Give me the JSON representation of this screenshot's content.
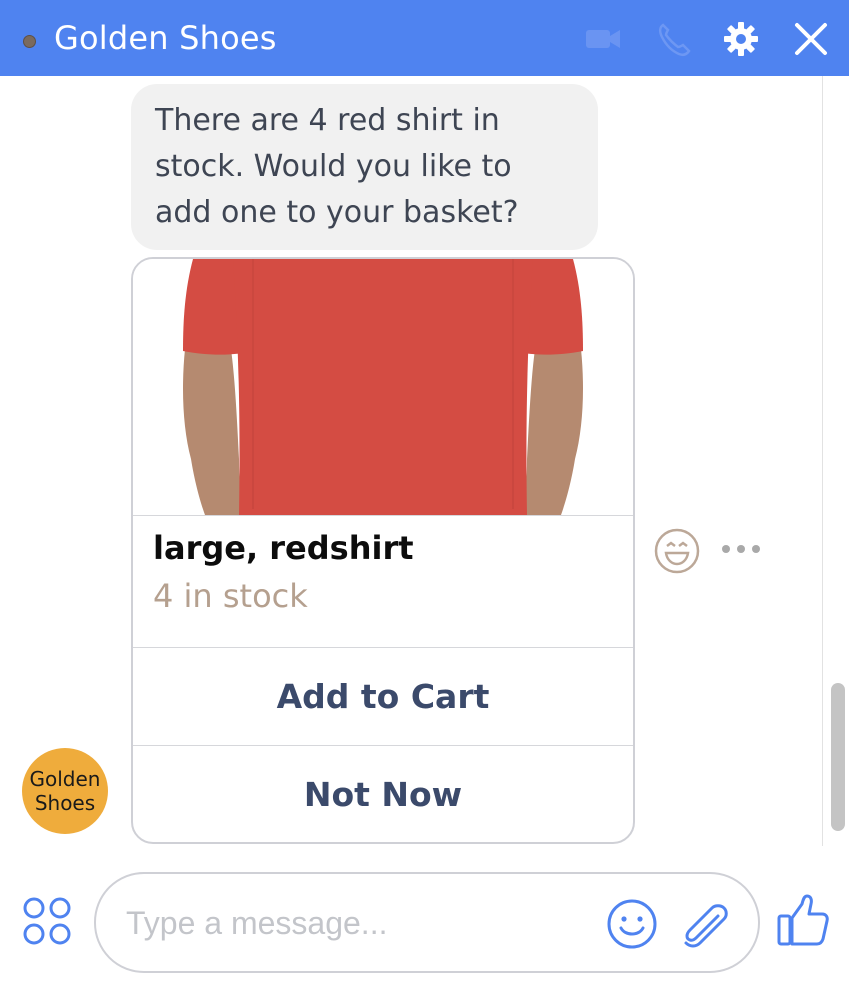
{
  "header": {
    "title": "Golden Shoes",
    "accent_color": "#4f83f0",
    "icons": [
      "video-call-icon",
      "phone-icon",
      "gear-icon",
      "close-icon"
    ]
  },
  "conversation": {
    "bot_message": "There are 4 red shirt in stock. Would you like to add one to your basket?",
    "avatar_text": "Golden Shoes",
    "avatar_color": "#efac3c"
  },
  "product_card": {
    "name": "large, redshirt",
    "stock": "4 in stock",
    "buttons": [
      "Add to Cart",
      "Not Now"
    ],
    "shirt_color": "#d44c43"
  },
  "composer": {
    "placeholder": "Type a message..."
  }
}
